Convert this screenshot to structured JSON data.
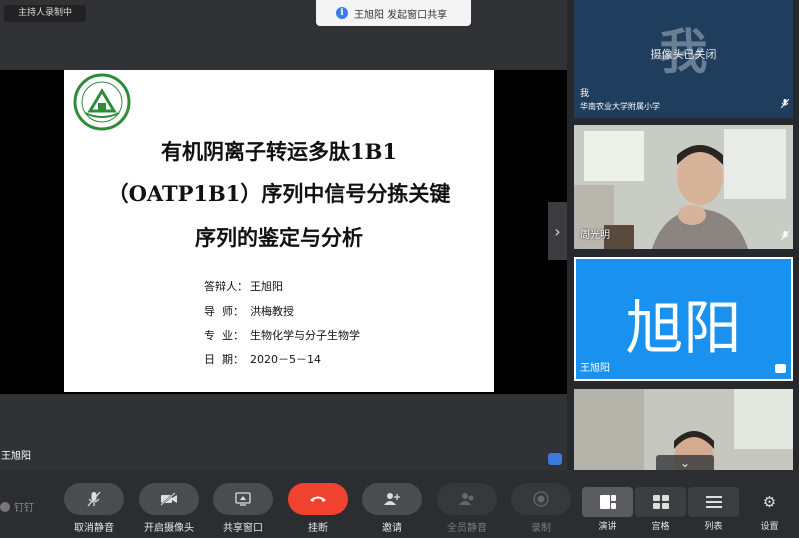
{
  "recording_badge": "主持人录制中",
  "share_toast": {
    "icon": "info-icon",
    "text": "王旭阳 发起窗口共享"
  },
  "slide": {
    "title_lines": [
      "有机阴离子转运多肽1B1",
      "（OATP1B1）序列中信号分拣关键",
      "序列的鉴定与分析"
    ],
    "meta": [
      {
        "key": "答辩人：",
        "value": "王旭阳"
      },
      {
        "key": "导  师：",
        "value": "洪梅教授"
      },
      {
        "key": "专  业：",
        "value": "生物化学与分子生物学"
      },
      {
        "key": "日  期：",
        "value": "2020－5－14"
      }
    ]
  },
  "presenter_name": "王旭阳",
  "participants": {
    "me": {
      "avatar_char": "我",
      "status": "摄像头已关闭",
      "name": "我",
      "org": "华南农业大学附属小学"
    },
    "zhou": {
      "name": "周光明"
    },
    "wang": {
      "avatar_text": "旭阳",
      "name": "王旭阳"
    }
  },
  "toolbar": {
    "brand": "钉钉",
    "buttons": [
      {
        "label": "取消静音",
        "icon": "mic-off-icon"
      },
      {
        "label": "开启摄像头",
        "icon": "camera-off-icon"
      },
      {
        "label": "共享窗口",
        "icon": "screen-share-icon"
      },
      {
        "label": "挂断",
        "icon": "hang-up-icon"
      },
      {
        "label": "邀请",
        "icon": "invite-icon"
      },
      {
        "label": "全员静音",
        "icon": "mute-all-icon"
      },
      {
        "label": "录制",
        "icon": "record-icon"
      }
    ],
    "views": [
      {
        "label": "演讲",
        "icon": "speaker-view-icon",
        "active": true
      },
      {
        "label": "宫格",
        "icon": "grid-view-icon",
        "active": false
      },
      {
        "label": "列表",
        "icon": "list-view-icon",
        "active": false
      }
    ],
    "settings_label": "设置"
  },
  "colors": {
    "hangup": "#f0422f",
    "active_tile": "#1a90ef",
    "accent": "#3b7be0"
  }
}
